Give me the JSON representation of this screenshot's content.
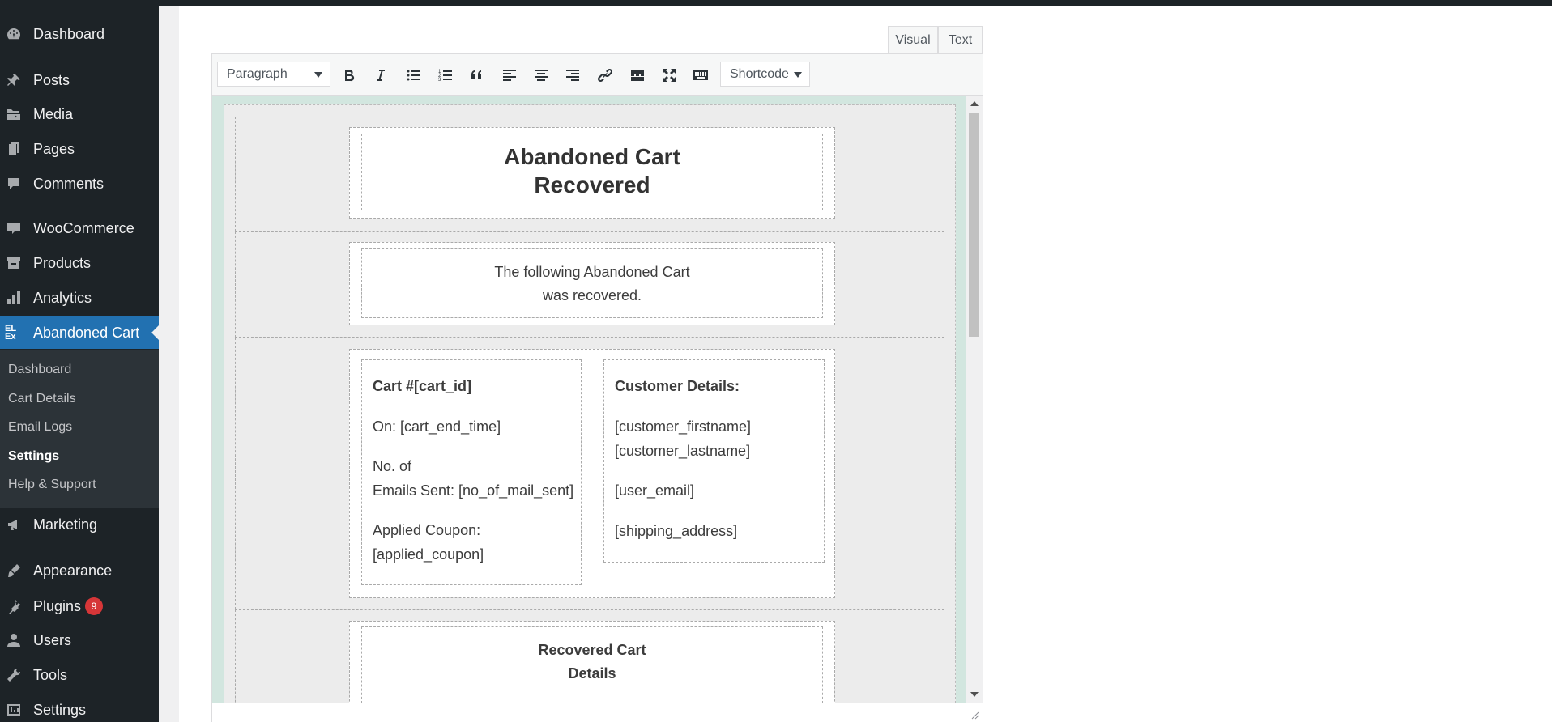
{
  "sidebar": {
    "menu": [
      {
        "id": "dashboard",
        "label": "Dashboard",
        "icon": "dashboard-icon"
      },
      {
        "id": "posts",
        "label": "Posts",
        "icon": "pin-icon"
      },
      {
        "id": "media",
        "label": "Media",
        "icon": "media-icon"
      },
      {
        "id": "pages",
        "label": "Pages",
        "icon": "pages-icon"
      },
      {
        "id": "comments",
        "label": "Comments",
        "icon": "comment-icon"
      },
      {
        "id": "woocommerce",
        "label": "WooCommerce",
        "icon": "woocommerce-icon"
      },
      {
        "id": "products",
        "label": "Products",
        "icon": "archive-icon"
      },
      {
        "id": "analytics",
        "label": "Analytics",
        "icon": "bar-chart-icon"
      },
      {
        "id": "abandoned-cart",
        "label": "Abandoned Cart",
        "icon": "elex-logo-icon"
      },
      {
        "id": "marketing",
        "label": "Marketing",
        "icon": "megaphone-icon"
      },
      {
        "id": "appearance",
        "label": "Appearance",
        "icon": "paintbrush-icon"
      },
      {
        "id": "plugins",
        "label": "Plugins",
        "icon": "plug-icon"
      },
      {
        "id": "users",
        "label": "Users",
        "icon": "user-icon"
      },
      {
        "id": "tools",
        "label": "Tools",
        "icon": "wrench-icon"
      },
      {
        "id": "settings",
        "label": "Settings",
        "icon": "settings-icon"
      }
    ],
    "logo_text": "EL Ex",
    "submenu": [
      "Dashboard",
      "Cart Details",
      "Email Logs",
      "Settings",
      "Help & Support"
    ],
    "plugins_badge": "9",
    "active_color": "#2271b1"
  },
  "editor": {
    "tabs": {
      "visual": "Visual",
      "text": "Text"
    },
    "format_select": "Paragraph",
    "shortcode_select": "Shortcode",
    "toolbar_icons": [
      "bold-icon",
      "italic-icon",
      "bullet-list-icon",
      "numbered-list-icon",
      "blockquote-icon",
      "align-left-icon",
      "align-center-icon",
      "align-right-icon",
      "link-icon",
      "read-more-icon",
      "fullscreen-icon",
      "keyboard-icon"
    ],
    "content": {
      "heading_line1": "Abandoned Cart",
      "heading_line2": "Recovered",
      "intro_line1": "The following Abandoned Cart",
      "intro_line2": "was recovered.",
      "cart_title": "Cart #[cart_id]",
      "cart_on": "On: [cart_end_time]",
      "cart_emails_line1": "No. of",
      "cart_emails_line2": "Emails Sent: [no_of_mail_sent]",
      "coupon_line1": "Applied Coupon:",
      "coupon_line2": "[applied_coupon]",
      "customer_title": "Customer Details:",
      "customer_firstname": "[customer_firstname]",
      "customer_lastname": "[customer_lastname]",
      "customer_email": "[user_email]",
      "customer_address": "[shipping_address]",
      "recovered_line1": "Recovered Cart",
      "recovered_line2": "Details"
    }
  }
}
